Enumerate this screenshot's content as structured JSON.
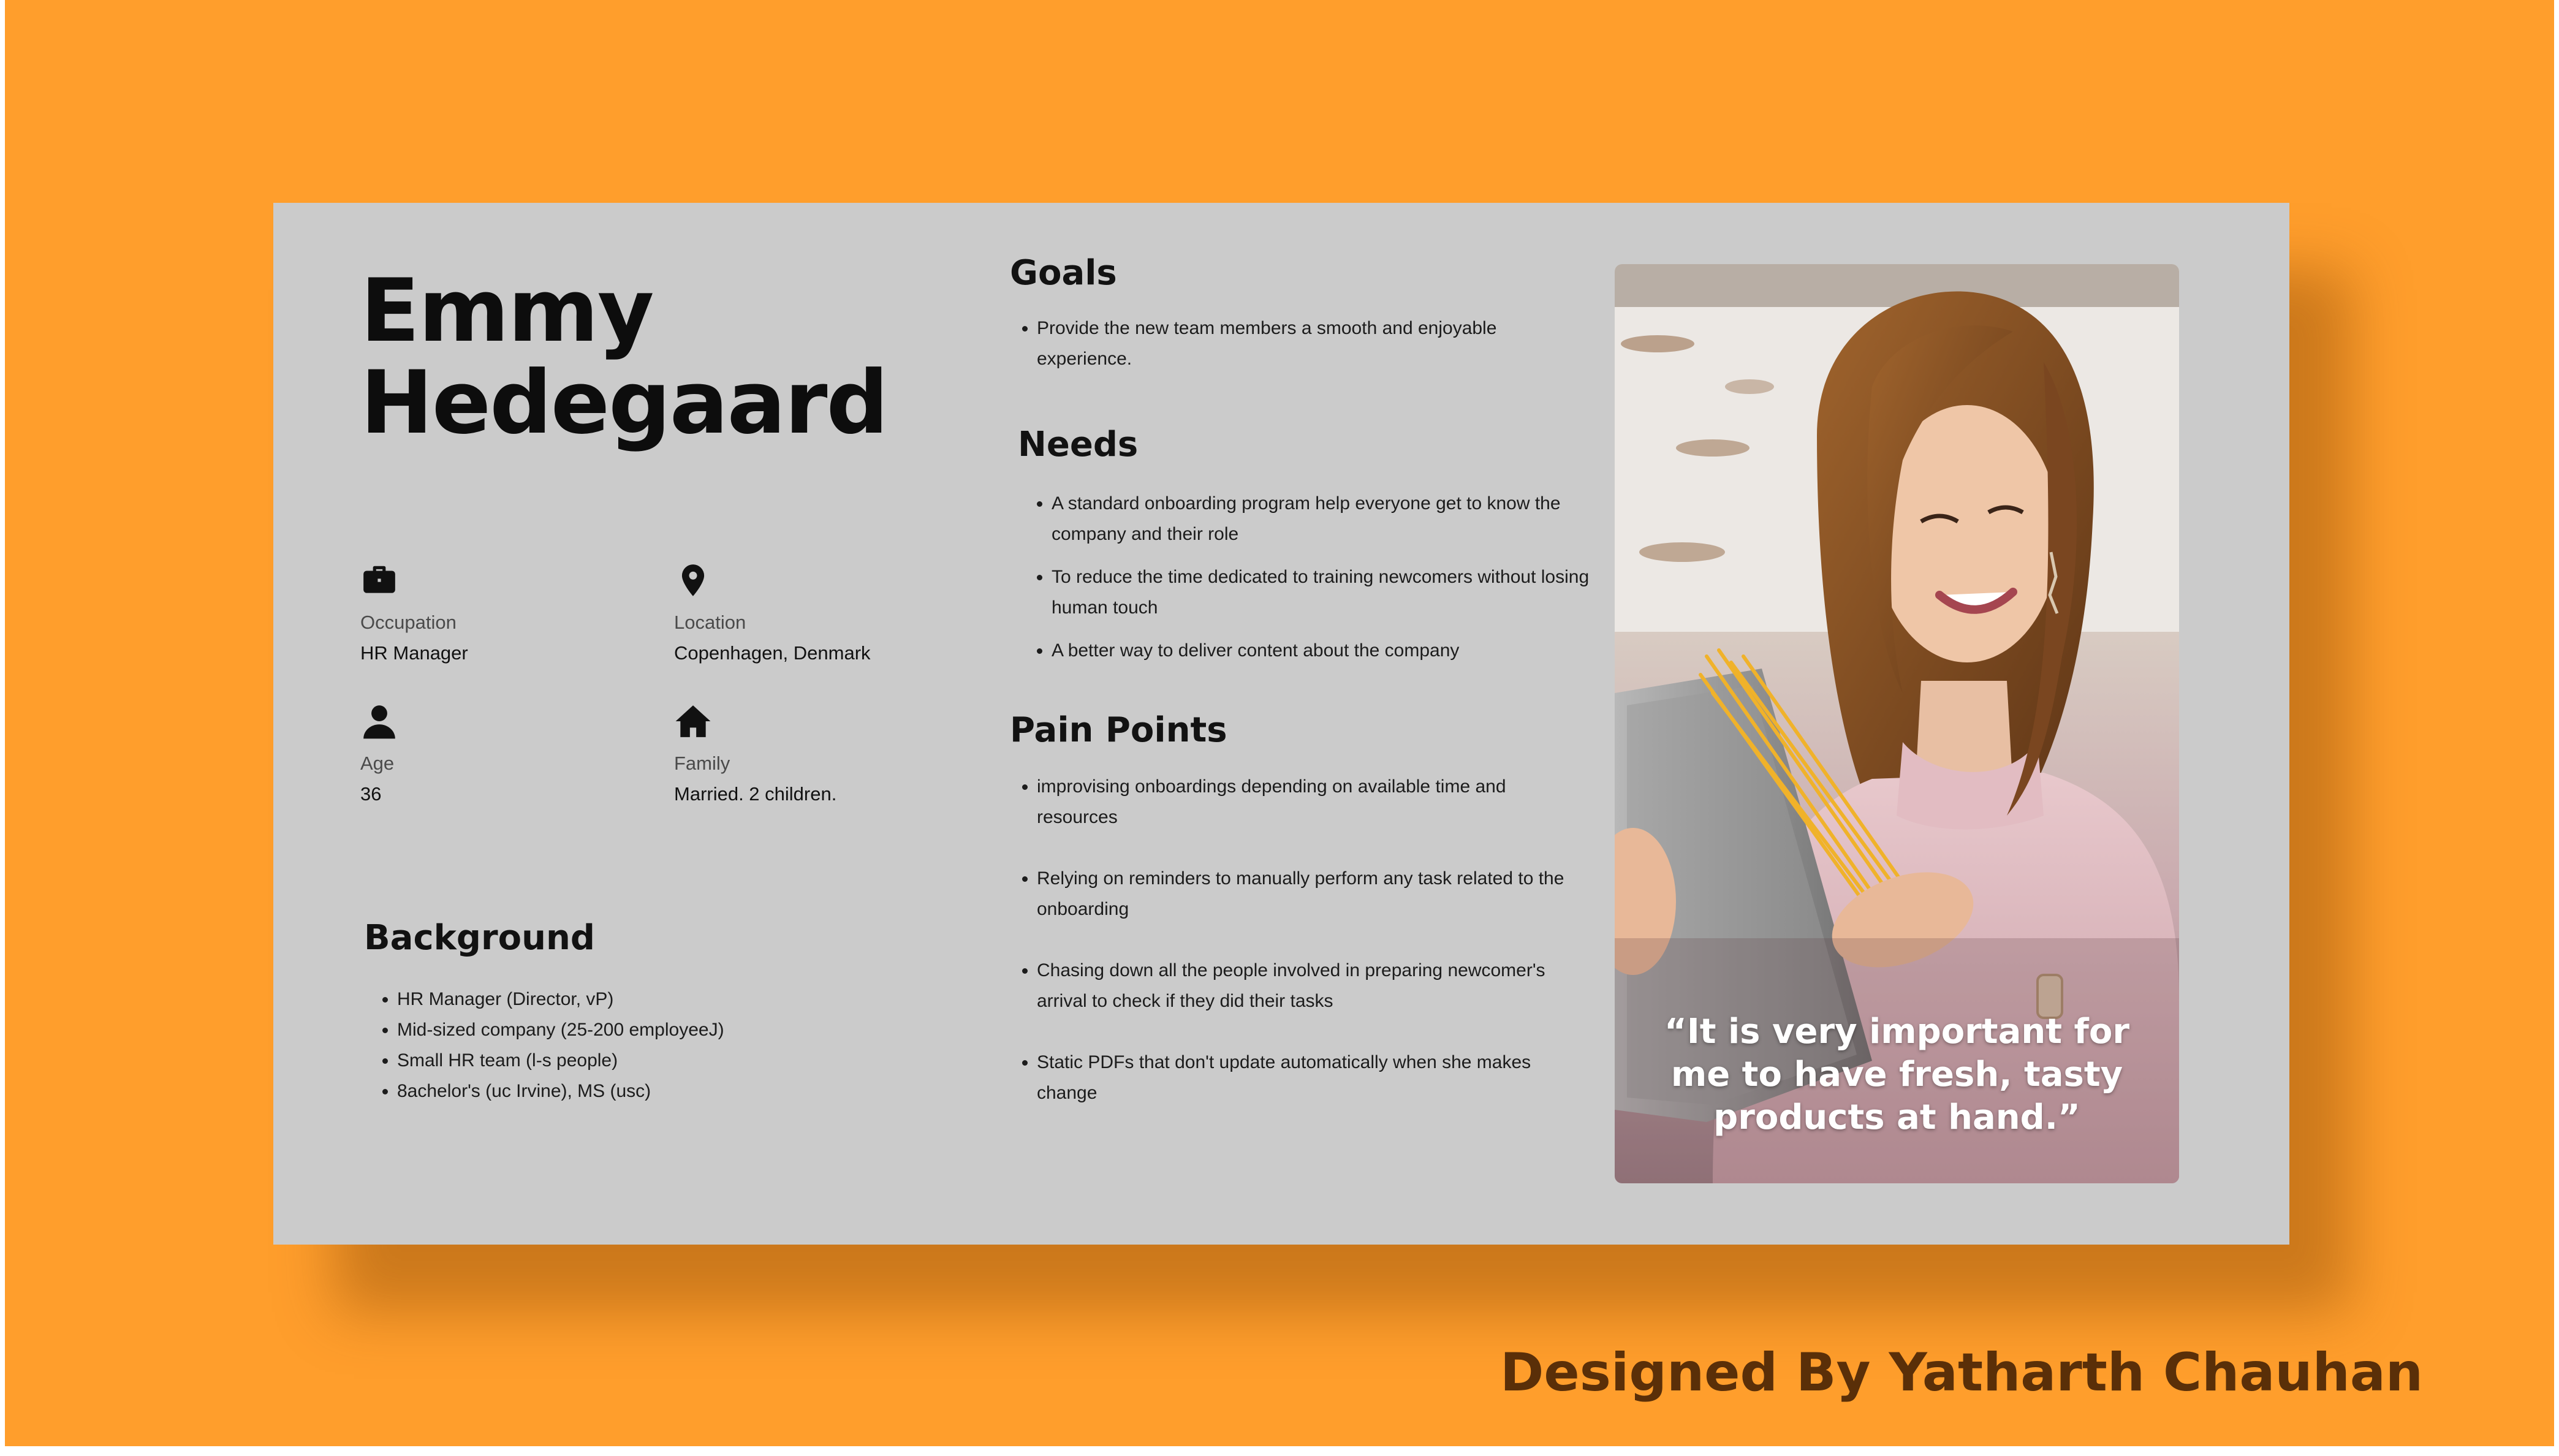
{
  "persona": {
    "name": "Emmy\nHedegaard",
    "occupation": {
      "label": "Occupation",
      "value": "HR Manager"
    },
    "location": {
      "label": "Location",
      "value": "Copenhagen, Denmark"
    },
    "age": {
      "label": "Age",
      "value": "36"
    },
    "family": {
      "label": "Family",
      "value": "Married. 2 children."
    }
  },
  "background": {
    "title": "Background",
    "items": [
      "HR Manager (Director, vP)",
      "Mid-sized company (25-200 employeeJ)",
      "Small HR team (l-s people)",
      "8achelor's (uc Irvine), MS (usc)"
    ]
  },
  "goals": {
    "title": "Goals",
    "items": [
      "Provide the new team members a smooth and enjoyable experience."
    ]
  },
  "needs": {
    "title": "Needs",
    "items": [
      "A standard onboarding program help everyone get to know the company and their role",
      "To reduce the time dedicated to training newcomers without losing human touch",
      "A better way to deliver content about the company"
    ]
  },
  "pain_points": {
    "title": "Pain Points",
    "items": [
      "improvising onboardings depending on available time and resources",
      "Relying on reminders to manually perform any task related to the onboarding",
      "Chasing down all the people involved in preparing newcomer's arrival to check if they did their tasks",
      "Static PDFs that don't update automatically when she makes change"
    ]
  },
  "quote": "“It is very important for me to have fresh, tasty products at hand.”",
  "credit": "Designed By Yatharth Chauhan",
  "icons": {
    "occupation": "briefcase-icon",
    "location": "map-pin-icon",
    "age": "person-icon",
    "family": "home-icon"
  },
  "colors": {
    "background": "#ff9e2c",
    "card": "#cbcbcb",
    "credit": "#5a2f08"
  }
}
